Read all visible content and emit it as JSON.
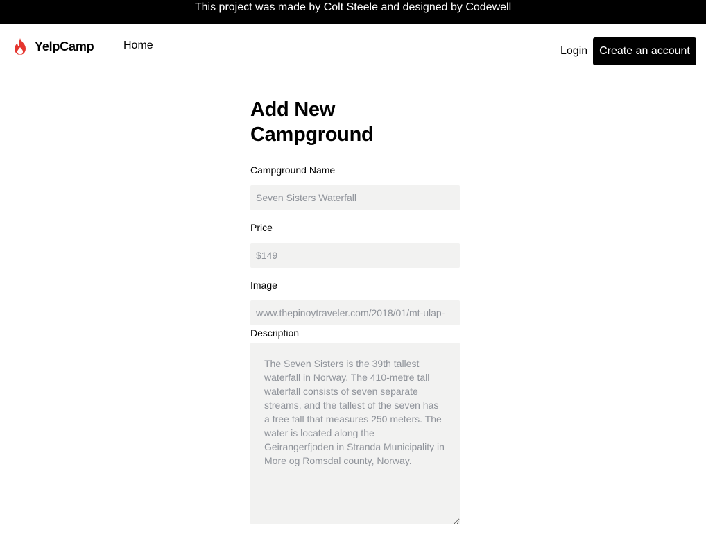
{
  "banner": {
    "text": "This project was made by Colt Steele and designed by Codewell"
  },
  "nav": {
    "logo_text": "YelpCamp",
    "home_label": "Home",
    "login_label": "Login",
    "create_account_label": "Create an account"
  },
  "form": {
    "title": "Add New Campground",
    "name": {
      "label": "Campground Name",
      "placeholder": "Seven Sisters Waterfall"
    },
    "price": {
      "label": "Price",
      "placeholder": "$149"
    },
    "image": {
      "label": "Image",
      "placeholder": "www.thepinoytraveler.com/2018/01/mt-ulap-"
    },
    "description": {
      "label": "Description",
      "placeholder": "The Seven Sisters is the 39th tallest waterfall in Norway. The 410-metre tall waterfall consists of seven separate streams, and the tallest of the seven has a free fall that measures 250 meters. The water is located along the Geirangerfjoden in Stranda Municipality in More og Romsdal county, Norway."
    }
  },
  "colors": {
    "banner_bg": "#000000",
    "logo_flame": "#e5362f",
    "input_bg": "#f2f2f1",
    "placeholder_text": "#8f939a",
    "primary_button": "#000000"
  },
  "icons": {
    "logo": "flame-icon"
  }
}
